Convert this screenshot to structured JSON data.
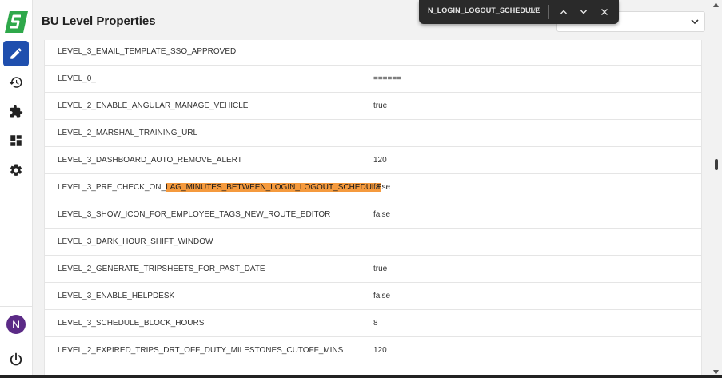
{
  "header": {
    "title": "BU Level Properties"
  },
  "find_bar": {
    "query": "N_LOGIN_LOGOUT_SCHEDULE",
    "count": "1/2"
  },
  "sidebar": {
    "items": [
      {
        "name": "edit",
        "icon": "pencil-icon",
        "active": true
      },
      {
        "name": "history",
        "icon": "history-icon"
      },
      {
        "name": "plugins",
        "icon": "puzzle-icon"
      },
      {
        "name": "dashboard",
        "icon": "dashboard-icon"
      },
      {
        "name": "settings",
        "icon": "gear-icon"
      }
    ],
    "avatar_initial": "N"
  },
  "table": {
    "rows": [
      {
        "key": "LEVEL_3_EMAIL_TEMPLATE_SSO_APPROVED",
        "value": ""
      },
      {
        "key": "LEVEL_0_",
        "value": "======"
      },
      {
        "key": "LEVEL_2_ENABLE_ANGULAR_MANAGE_VEHICLE",
        "value": "true"
      },
      {
        "key": "LEVEL_2_MARSHAL_TRAINING_URL",
        "value": ""
      },
      {
        "key": "LEVEL_3_DASHBOARD_AUTO_REMOVE_ALERT",
        "value": "120"
      },
      {
        "key_prefix": "LEVEL_3_PRE_CHECK_ON_",
        "key_highlight": "LAG_MINUTES_BETWEEN_LOGIN_LOGOUT_SCHEDULE",
        "value": "false"
      },
      {
        "key": "LEVEL_3_SHOW_ICON_FOR_EMPLOYEE_TAGS_NEW_ROUTE_EDITOR",
        "value": "false"
      },
      {
        "key": "LEVEL_3_DARK_HOUR_SHIFT_WINDOW",
        "value": ""
      },
      {
        "key": "LEVEL_2_GENERATE_TRIPSHEETS_FOR_PAST_DATE",
        "value": "true"
      },
      {
        "key": "LEVEL_3_ENABLE_HELPDESK",
        "value": "false"
      },
      {
        "key": "LEVEL_3_SCHEDULE_BLOCK_HOURS",
        "value": "8"
      },
      {
        "key": "LEVEL_2_EXPIRED_TRIPS_DRT_OFF_DUTY_MILESTONES_CUTOFF_MINS",
        "value": "120"
      }
    ]
  },
  "colors": {
    "accent": "#1f4fae",
    "logo": "#2ea84a",
    "highlight": "#f59a3d",
    "avatar": "#5b2a86"
  }
}
